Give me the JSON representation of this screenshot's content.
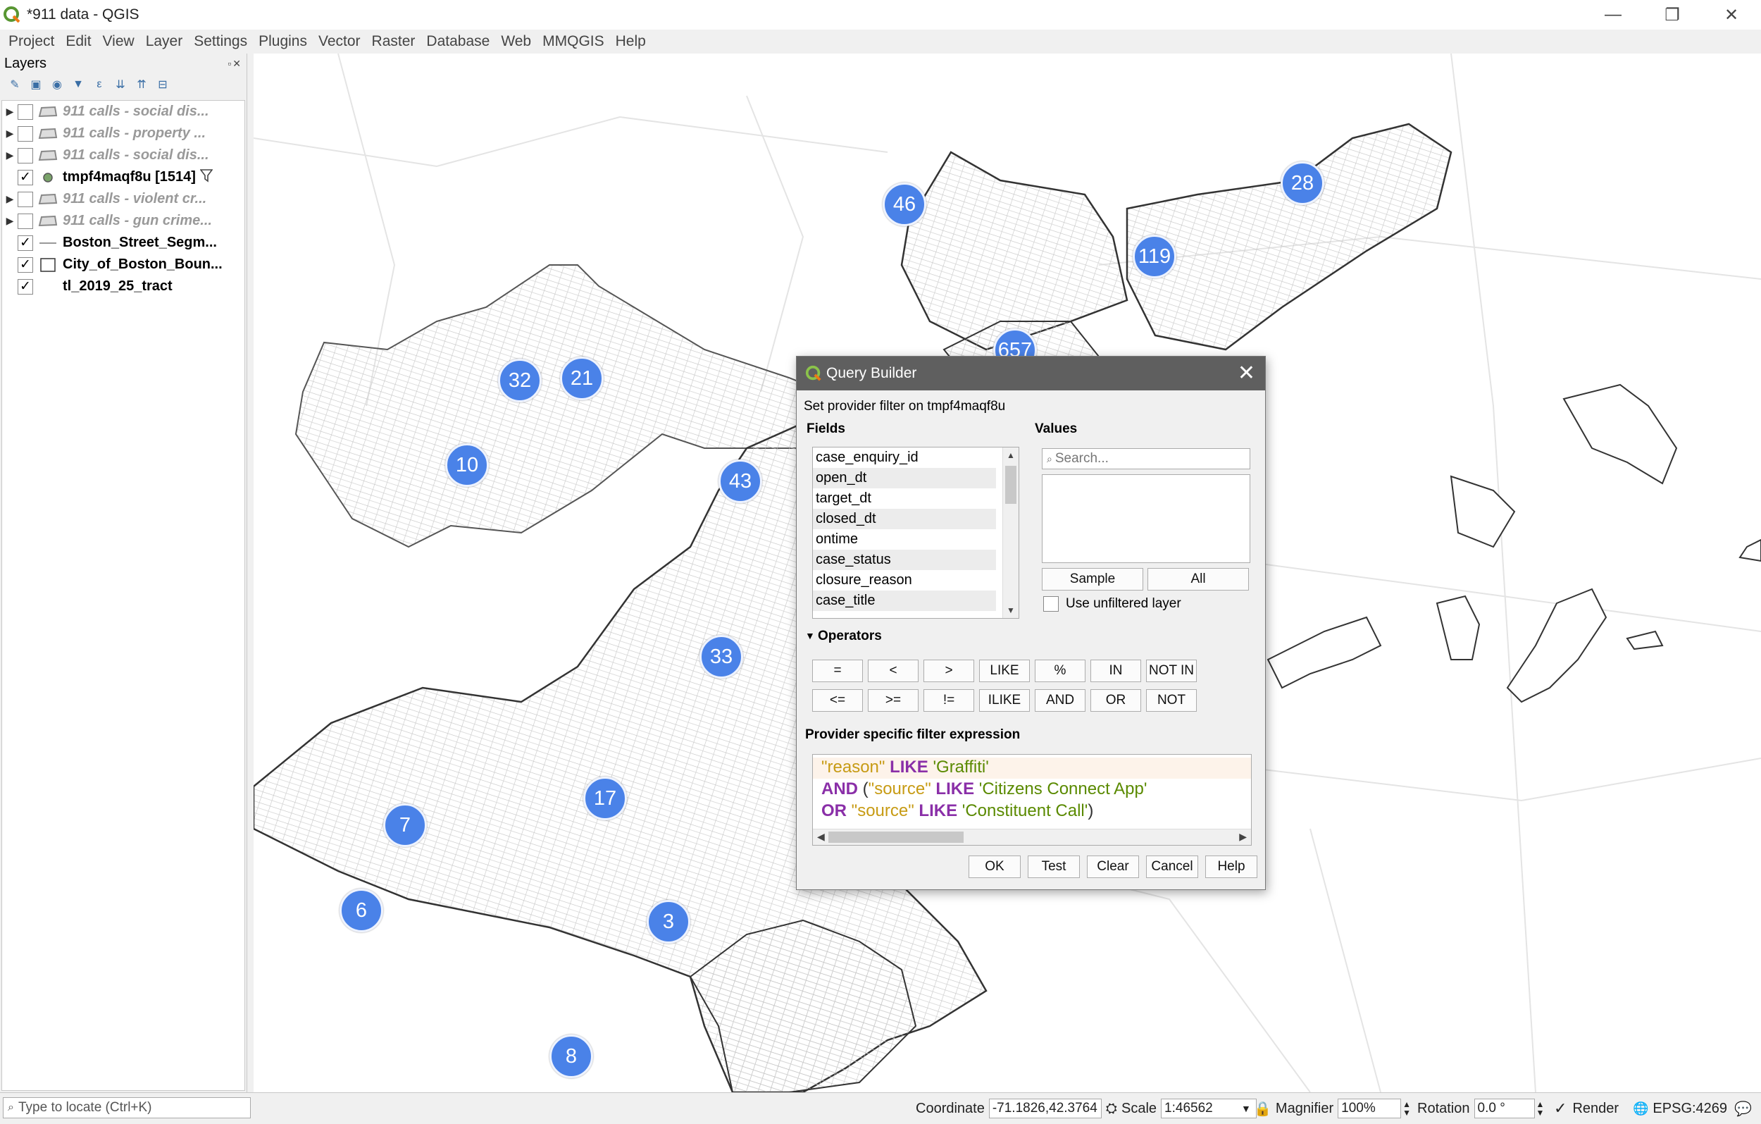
{
  "window": {
    "title": "*911 data - QGIS",
    "minimize": "—",
    "restore": "❐",
    "close": "✕"
  },
  "menu": [
    "Project",
    "Edit",
    "View",
    "Layer",
    "Settings",
    "Plugins",
    "Vector",
    "Raster",
    "Database",
    "Web",
    "MMQGIS",
    "Help"
  ],
  "layers_panel": {
    "title": "Layers",
    "panel_controls": "▫✕",
    "layers": [
      {
        "name": "911 calls - social dis...",
        "checked": false,
        "expandable": true,
        "style": "disabled"
      },
      {
        "name": "911 calls - property ...",
        "checked": false,
        "expandable": true,
        "style": "disabled"
      },
      {
        "name": "911 calls - social dis...",
        "checked": false,
        "expandable": true,
        "style": "disabled"
      },
      {
        "name": "tmpf4maqf8u [1514]",
        "checked": true,
        "expandable": false,
        "style": "active"
      },
      {
        "name": "911 calls - violent cr...",
        "checked": false,
        "expandable": true,
        "style": "disabled"
      },
      {
        "name": "911 calls - gun crime...",
        "checked": false,
        "expandable": true,
        "style": "disabled"
      },
      {
        "name": "Boston_Street_Segm...",
        "checked": true,
        "expandable": false,
        "style": "bold"
      },
      {
        "name": "City_of_Boston_Boun...",
        "checked": true,
        "expandable": false,
        "style": "bold"
      },
      {
        "name": "tl_2019_25_tract",
        "checked": true,
        "expandable": false,
        "style": "bold"
      }
    ]
  },
  "map": {
    "clusters": [
      "46",
      "28",
      "119",
      "657",
      "32",
      "21",
      "10",
      "43",
      "33",
      "17",
      "7",
      "6",
      "3",
      "8"
    ]
  },
  "query_builder": {
    "title": "Query Builder",
    "close": "✕",
    "provider_label": "Set provider filter on tmpf4maqf8u",
    "fields_label": "Fields",
    "values_label": "Values",
    "fields": [
      "case_enquiry_id",
      "open_dt",
      "target_dt",
      "closed_dt",
      "ontime",
      "case_status",
      "closure_reason",
      "case_title"
    ],
    "search_placeholder": "Search...",
    "sample_button": "Sample",
    "all_button": "All",
    "unfiltered_label": "Use unfiltered layer",
    "operators_label": "Operators",
    "operators_row1": [
      "=",
      "<",
      ">",
      "LIKE",
      "%",
      "IN",
      "NOT IN"
    ],
    "operators_row2": [
      "<=",
      ">=",
      "!=",
      "ILIKE",
      "AND",
      "OR",
      "NOT"
    ],
    "expression_label": "Provider specific filter expression",
    "expression": {
      "line1": {
        "field": "\"reason\"",
        "op": "LIKE",
        "value": "'Graffiti'"
      },
      "line2": {
        "op1": "AND",
        "paren": "(",
        "field": "\"source\"",
        "op2": "LIKE",
        "value": "'Citizens Connect App'"
      },
      "line3": {
        "op1": "OR",
        "field": "\"source\"",
        "op2": "LIKE",
        "value": "'Constituent Call'",
        "paren": ")"
      }
    },
    "buttons": {
      "ok": "OK",
      "test": "Test",
      "clear": "Clear",
      "cancel": "Cancel",
      "help": "Help"
    }
  },
  "statusbar": {
    "locator_placeholder": "Type to locate (Ctrl+K)",
    "coordinate_label": "Coordinate",
    "coordinate_value": "-71.1826,42.3764",
    "scale_label": "Scale",
    "scale_value": "1:46562",
    "magnifier_label": "Magnifier",
    "magnifier_value": "100%",
    "rotation_label": "Rotation",
    "rotation_value": "0.0 °",
    "render_label": "Render",
    "crs": "EPSG:4269"
  },
  "colors": {
    "cluster": "#4a82e8",
    "dialog_title": "#5f5f5f"
  }
}
